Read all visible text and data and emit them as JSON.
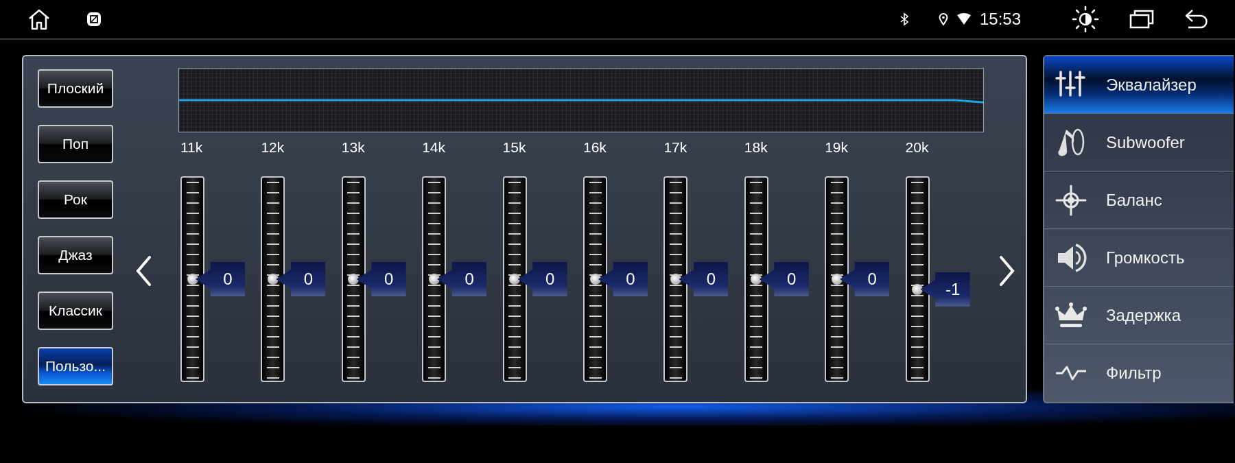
{
  "status_bar": {
    "time": "15:53"
  },
  "presets": [
    {
      "label": "Плоский",
      "selected": false
    },
    {
      "label": "Поп",
      "selected": false
    },
    {
      "label": "Рок",
      "selected": false
    },
    {
      "label": "Джаз",
      "selected": false
    },
    {
      "label": "Классик",
      "selected": false
    },
    {
      "label": "Пользо...",
      "selected": true
    }
  ],
  "bands": [
    {
      "label": "11k",
      "value": "0",
      "level": 0.5
    },
    {
      "label": "12k",
      "value": "0",
      "level": 0.5
    },
    {
      "label": "13k",
      "value": "0",
      "level": 0.5
    },
    {
      "label": "14k",
      "value": "0",
      "level": 0.5
    },
    {
      "label": "15k",
      "value": "0",
      "level": 0.5
    },
    {
      "label": "16k",
      "value": "0",
      "level": 0.5
    },
    {
      "label": "17k",
      "value": "0",
      "level": 0.5
    },
    {
      "label": "18k",
      "value": "0",
      "level": 0.5
    },
    {
      "label": "19k",
      "value": "0",
      "level": 0.5
    },
    {
      "label": "20k",
      "value": "-1",
      "level": 0.45
    }
  ],
  "menu": [
    {
      "label": "Эквалайзер",
      "kind": "equalizer",
      "selected": true
    },
    {
      "label": "Subwoofer",
      "kind": "subwoofer",
      "selected": false
    },
    {
      "label": "Баланс",
      "kind": "balance",
      "selected": false
    },
    {
      "label": "Громкость",
      "kind": "volume",
      "selected": false
    },
    {
      "label": "Задержка",
      "kind": "delay",
      "selected": false
    },
    {
      "label": "Фильтр",
      "kind": "filter",
      "selected": false
    }
  ]
}
